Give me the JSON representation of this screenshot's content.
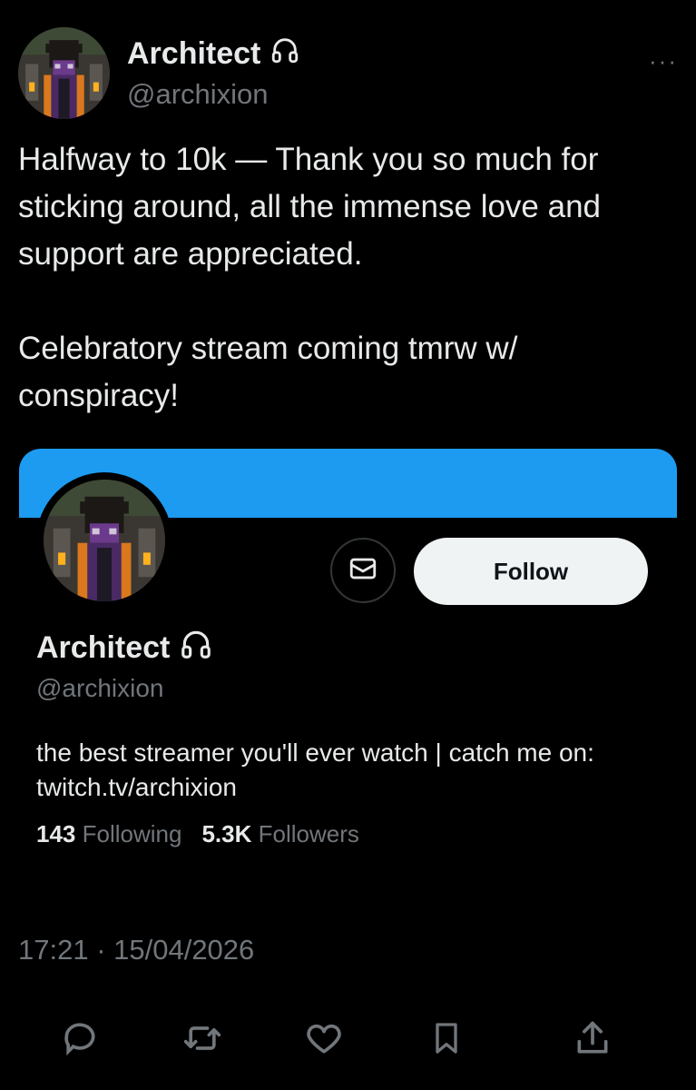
{
  "tweet": {
    "author_name": "Architect",
    "author_handle": "@archixion",
    "more_label": "···",
    "text_p1": "Halfway to 10k — Thank you so much for sticking around, all the immense love and support are appreciated.",
    "text_p2": "Celebratory stream coming tmrw w/ conspiracy!",
    "timestamp": "17:21 · 15/04/2026"
  },
  "card": {
    "name": "Architect",
    "handle": "@archixion",
    "follow_label": "Follow",
    "bio": "the best streamer you'll ever watch | catch me on: twitch.tv/archixion",
    "following_count": "143",
    "following_label": "Following",
    "followers_count": "5.3K",
    "followers_label": "Followers"
  },
  "icons": {
    "name_badge": "headphones-icon",
    "message": "mail-icon",
    "reply": "reply-icon",
    "retweet": "retweet-icon",
    "like": "heart-icon",
    "bookmark": "bookmark-icon",
    "share": "share-icon"
  },
  "colors": {
    "background": "#000000",
    "banner": "#1d9bf0",
    "text": "#e7e9ea",
    "secondary_text": "#71767b",
    "follow_button": "#eff3f4"
  }
}
